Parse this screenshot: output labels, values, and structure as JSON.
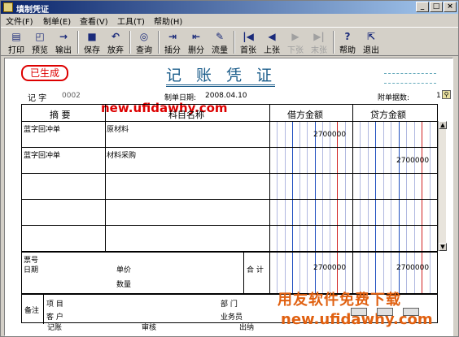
{
  "window": {
    "title": "填制凭证",
    "min_label": "_",
    "max_label": "□",
    "close_label": "×"
  },
  "menu": [
    "文件(F)",
    "制单(E)",
    "查看(V)",
    "工具(T)",
    "帮助(H)"
  ],
  "toolbar": {
    "print": "打印",
    "preview": "预览",
    "export": "输出",
    "save": "保存",
    "abandon": "放弃",
    "query": "查询",
    "insert": "插分",
    "delete": "删分",
    "flow": "流量",
    "first": "首张",
    "prev": "上张",
    "next": "下张",
    "last": "末张",
    "help": "帮助",
    "exit": "退出"
  },
  "voucher": {
    "status_stamp": "已生成",
    "title": "记 账 凭 证",
    "type_label": "记 字",
    "number": "0002",
    "date_label": "制单日期:",
    "date": "2008.04.10",
    "attachments_label": "附单据数:",
    "attachments": "1",
    "headers": {
      "summary": "摘 要",
      "subject": "科目名称",
      "debit": "借方金额",
      "credit": "贷方金额"
    },
    "rows": [
      {
        "summary": "蓝字回冲单",
        "subject": "原材料",
        "debit": "2700000",
        "credit": ""
      },
      {
        "summary": "蓝字回冲单",
        "subject": "材料采购",
        "debit": "",
        "credit": "2700000"
      },
      {
        "summary": "",
        "subject": "",
        "debit": "",
        "credit": ""
      },
      {
        "summary": "",
        "subject": "",
        "debit": "",
        "credit": ""
      }
    ],
    "footer": {
      "ticket_no": "票号",
      "date": "日期",
      "unit_price": "单价",
      "quantity": "数量",
      "total_label": "合 计",
      "total_debit": "2700000",
      "total_credit": "2700000"
    },
    "notes": {
      "label": "备注",
      "project": "项 目",
      "customer": "客 户",
      "department": "部 门",
      "salesperson": "业务员"
    },
    "signatures": {
      "bookkeeper": "记账",
      "auditor": "审核",
      "cashier": "出纳"
    }
  },
  "watermarks": {
    "top": "new.ufidawhy.com",
    "bottom_cn": "用友软件免费下载",
    "bottom_en": "new.ufidawhy.com"
  },
  "colors": {
    "title": "#1a5c8a",
    "stamp": "#dd0000",
    "watermark_red": "#dd0000",
    "watermark_orange": "#e06010"
  }
}
